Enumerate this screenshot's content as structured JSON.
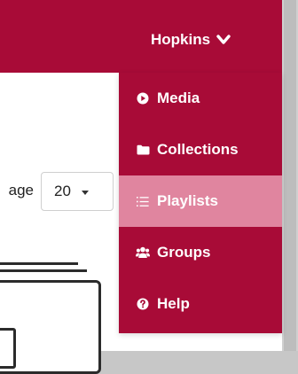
{
  "header": {
    "user_name": "Hopkins",
    "bg_color": "#a80b37"
  },
  "controls": {
    "per_page_label": "age",
    "per_page_value": "20"
  },
  "menu": {
    "items": [
      {
        "label": "Media",
        "icon": "play-circle-icon"
      },
      {
        "label": "Collections",
        "icon": "folder-icon"
      },
      {
        "label": "Playlists",
        "icon": "list-icon",
        "active": true
      },
      {
        "label": "Groups",
        "icon": "users-icon"
      },
      {
        "label": "Help",
        "icon": "question-circle-icon"
      }
    ],
    "active_bg": "#e0859f"
  }
}
